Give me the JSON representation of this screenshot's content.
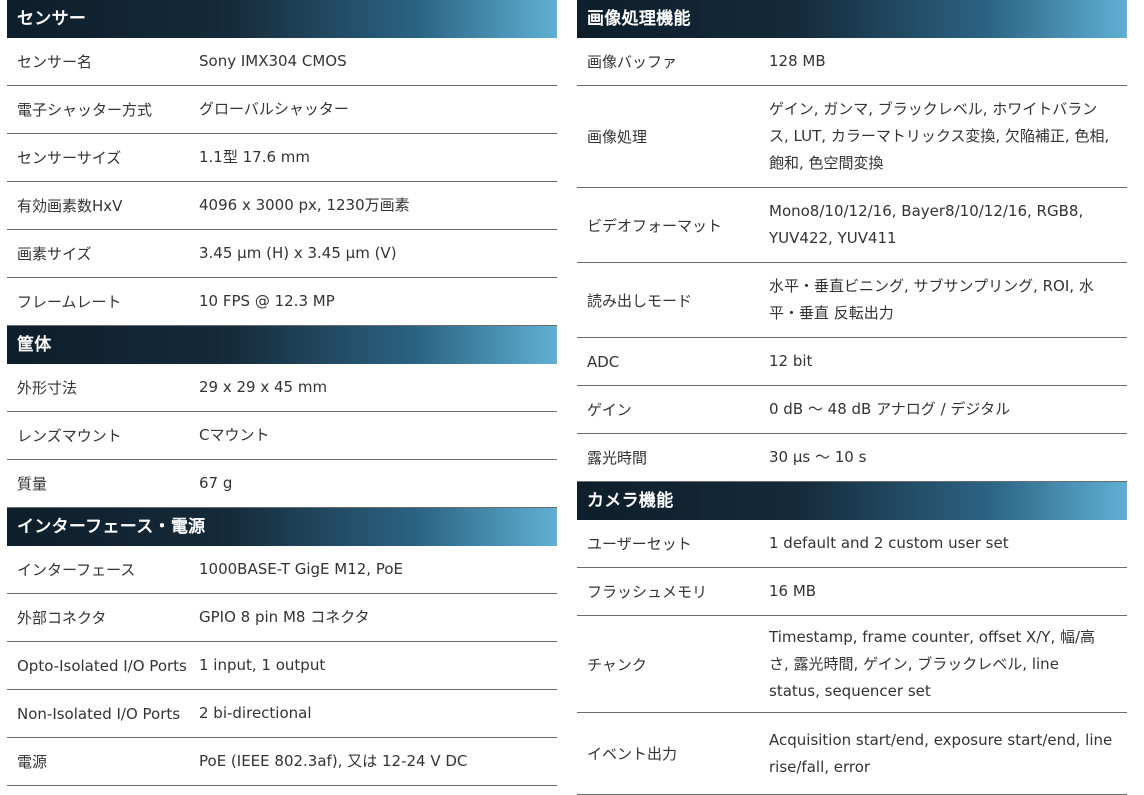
{
  "left": {
    "sensor": {
      "title": "センサー",
      "rows": [
        {
          "label": "センサー名",
          "value": "Sony IMX304 CMOS"
        },
        {
          "label": "電子シャッター方式",
          "value": "グローバルシャッター"
        },
        {
          "label": "センサーサイズ",
          "value": "1.1型 17.6 mm"
        },
        {
          "label": "有効画素数HxV",
          "value": "4096 x 3000 px, 1230万画素"
        },
        {
          "label": "画素サイズ",
          "value": "3.45 µm (H) x 3.45 µm (V)"
        },
        {
          "label": "フレームレート",
          "value": "10 FPS @ 12.3 MP"
        }
      ]
    },
    "housing": {
      "title": "筐体",
      "rows": [
        {
          "label": "外形寸法",
          "value": "29 x 29 x 45 mm"
        },
        {
          "label": "レンズマウント",
          "value": "Cマウント"
        },
        {
          "label": "質量",
          "value": "67 g"
        }
      ]
    },
    "interface": {
      "title": "インターフェース・電源",
      "rows": [
        {
          "label": "インターフェース",
          "value": "1000BASE-T GigE M12, PoE"
        },
        {
          "label": "外部コネクタ",
          "value": "GPIO 8 pin M8 コネクタ"
        },
        {
          "label": "Opto-Isolated I/O Ports",
          "value": "1 input, 1 output"
        },
        {
          "label": "Non-Isolated I/O Ports",
          "value": "2 bi-directional"
        },
        {
          "label": "電源",
          "value": "PoE (IEEE 802.3af), 又は 12-24 V DC"
        }
      ]
    }
  },
  "right": {
    "imaging": {
      "title": "画像処理機能",
      "rows": [
        {
          "label": "画像バッファ",
          "value": "128 MB"
        },
        {
          "label": "画像処理",
          "value": "ゲイン, ガンマ, ブラックレベル, ホワイトバランス, LUT, カラーマトリックス変換, 欠陥補正, 色相, 飽和, 色空間変換"
        },
        {
          "label": "ビデオフォーマット",
          "value": "Mono8/10/12/16, Bayer8/10/12/16, RGB8, YUV422, YUV411"
        },
        {
          "label": "読み出しモード",
          "value": "水平・垂直ビニング, サブサンプリング, ROI, 水平・垂直 反転出力"
        },
        {
          "label": "ADC",
          "value": "12 bit"
        },
        {
          "label": "ゲイン",
          "value": "0 dB ～ 48 dB アナログ / デジタル"
        },
        {
          "label": "露光時間",
          "value": "30 µs ～ 10 s"
        }
      ]
    },
    "camera": {
      "title": "カメラ機能",
      "rows": [
        {
          "label": "ユーザーセット",
          "value": "1 default and 2 custom user set"
        },
        {
          "label": "フラッシュメモリ",
          "value": "16 MB"
        },
        {
          "label": "チャンク",
          "value": "Timestamp, frame counter, offset X/Y, 幅/高さ, 露光時間, ゲイン, ブラックレベル, line status, sequencer set"
        },
        {
          "label": "イベント出力",
          "value": "Acquisition start/end, exposure start/end, line rise/fall, error"
        }
      ]
    }
  }
}
